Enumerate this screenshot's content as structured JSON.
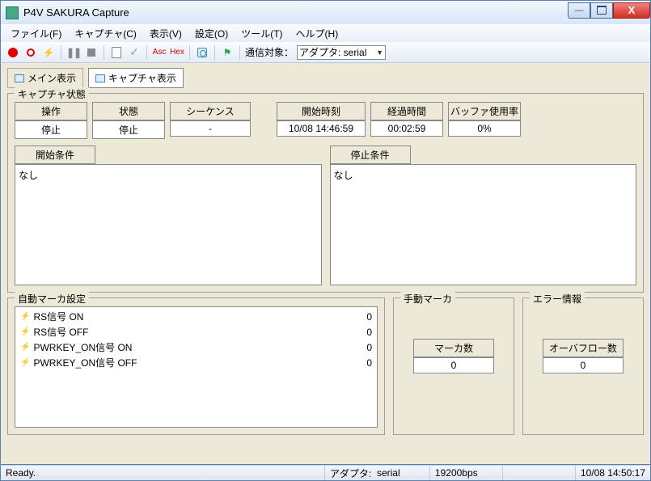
{
  "window": {
    "title": "P4V SAKURA Capture"
  },
  "menu": {
    "file": "ファイル(F)",
    "capture": "キャプチャ(C)",
    "view": "表示(V)",
    "settings": "設定(O)",
    "tools": "ツール(T)",
    "help": "ヘルプ(H)"
  },
  "toolbar": {
    "asc": "Asc",
    "hex": "Hex",
    "target_label": "通信対象：",
    "target_value": "アダプタ: serial"
  },
  "tabs": {
    "main": "メイン表示",
    "capture": "キャプチャ表示"
  },
  "capture_state": {
    "legend": "キャプチャ状態",
    "headers": {
      "operation": "操作",
      "state": "状態",
      "sequence": "シーケンス",
      "start_time": "開始時刻",
      "elapsed": "経過時間",
      "buffer": "バッファ使用率"
    },
    "values": {
      "operation": "停止",
      "state": "停止",
      "sequence": "-",
      "start_time": "10/08 14:46:59",
      "elapsed": "00:02:59",
      "buffer": "0%"
    },
    "start_cond_label": "開始条件",
    "stop_cond_label": "停止条件",
    "start_cond_value": "なし",
    "stop_cond_value": "なし"
  },
  "auto_marker": {
    "legend": "自動マーカ設定",
    "items": [
      {
        "label": "RS信号 ON",
        "count": "0"
      },
      {
        "label": "RS信号 OFF",
        "count": "0"
      },
      {
        "label": "PWRKEY_ON信号 ON",
        "count": "0"
      },
      {
        "label": "PWRKEY_ON信号 OFF",
        "count": "0"
      }
    ]
  },
  "manual_marker": {
    "legend": "手動マーカ",
    "count_label": "マーカ数",
    "count_value": "0"
  },
  "error_info": {
    "legend": "エラー情報",
    "overflow_label": "オーバフロー数",
    "overflow_value": "0"
  },
  "status": {
    "ready": "Ready.",
    "adapter_label": "アダプタ:",
    "adapter_value": "serial",
    "baud": "19200bps",
    "clock": "10/08 14:50:17"
  }
}
